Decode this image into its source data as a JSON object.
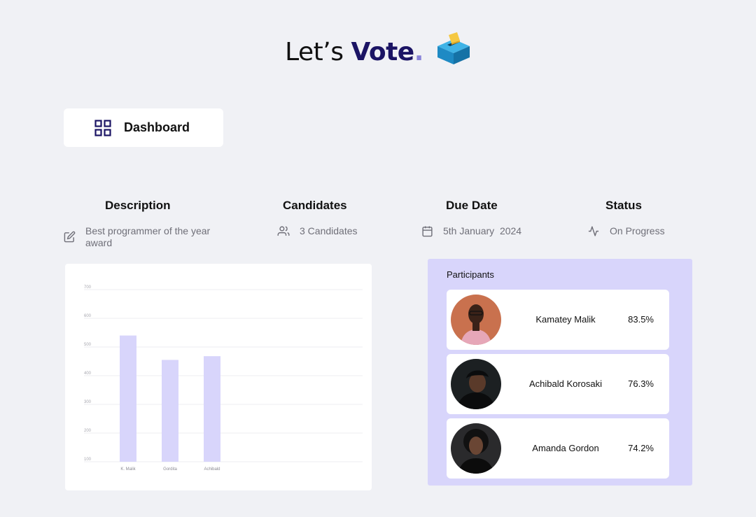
{
  "header": {
    "title_prefix": "Let’s ",
    "title_emphasis": "Vote",
    "title_dot": ".",
    "icon": "ballot-box-icon"
  },
  "nav": {
    "dashboard_label": "Dashboard",
    "icon": "grid-icon"
  },
  "info": {
    "description": {
      "heading": "Description",
      "line1": "Best programmer of the year",
      "line2": "award",
      "icon": "edit-icon"
    },
    "candidates": {
      "heading": "Candidates",
      "value": "3 Candidates",
      "icon": "users-icon"
    },
    "due_date": {
      "heading": "Due Date",
      "value": "5th January  2024",
      "icon": "calendar-icon"
    },
    "status": {
      "heading": "Status",
      "value": "On Progress",
      "icon": "activity-icon"
    }
  },
  "chart_data": {
    "type": "bar",
    "categories": [
      "K. Malik",
      "Gordita",
      "Achibald"
    ],
    "values": [
      540,
      455,
      468
    ],
    "yticks": [
      100,
      200,
      300,
      400,
      500,
      600,
      700
    ],
    "ylim": [
      100,
      700
    ],
    "grid": true,
    "bar_color": "#d8d5fb"
  },
  "participants": {
    "title": "Participants",
    "items": [
      {
        "name": "Kamatey Malik",
        "percent": "83.5%"
      },
      {
        "name": "Achibald Korosaki",
        "percent": "76.3%"
      },
      {
        "name": "Amanda Gordon",
        "percent": "74.2%"
      }
    ]
  },
  "colors": {
    "accent": "#1b1464",
    "panel": "#d8d5fb",
    "background": "#f0f1f5"
  }
}
